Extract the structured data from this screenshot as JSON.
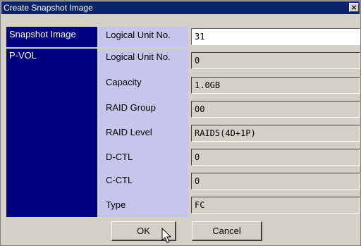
{
  "window": {
    "title": "Create Snapshot Image",
    "close_glyph": "×"
  },
  "snapshot_section": {
    "heading": "Snapshot Image",
    "field_label": "Logical Unit No.",
    "field_value": "31"
  },
  "pvol_section": {
    "heading": "P-VOL",
    "fields": [
      {
        "label": "Logical Unit No.",
        "value": "0"
      },
      {
        "label": "Capacity",
        "value": "1.0GB"
      },
      {
        "label": "RAID Group",
        "value": "00"
      },
      {
        "label": "RAID Level",
        "value": "RAID5(4D+1P)"
      },
      {
        "label": "D-CTL",
        "value": "0"
      },
      {
        "label": "C-CTL",
        "value": "0"
      },
      {
        "label": "Type",
        "value": "FC"
      }
    ]
  },
  "buttons": {
    "ok_label": "OK",
    "cancel_label": "Cancel"
  },
  "colors": {
    "titlebar": "#0a246a",
    "section_heading_bg": "#000080",
    "label_bg": "#c6c6ec",
    "window_bg": "#d4d0c8"
  },
  "icons": {
    "cursor": "arrow-pointer-icon",
    "close": "close-icon"
  }
}
